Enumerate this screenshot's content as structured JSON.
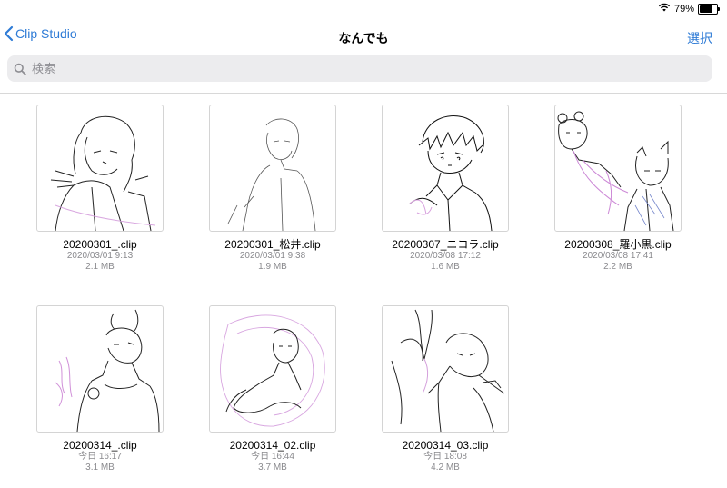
{
  "status": {
    "battery": "79%",
    "battery_level": 0.79
  },
  "nav": {
    "back_label": "Clip Studio",
    "title": "なんでも",
    "select_label": "選択"
  },
  "search": {
    "placeholder": "検索"
  },
  "colors": {
    "accent": "#2e7bd6"
  },
  "files": [
    {
      "name": "20200301_.clip",
      "date": "2020/03/01 9:13",
      "size": "2.1 MB"
    },
    {
      "name": "20200301_松井.clip",
      "date": "2020/03/01 9:38",
      "size": "1.9 MB"
    },
    {
      "name": "20200307_ニコラ.clip",
      "date": "2020/03/08 17:12",
      "size": "1.6 MB"
    },
    {
      "name": "20200308_羅小黒.clip",
      "date": "2020/03/08 17:41",
      "size": "2.2 MB"
    },
    {
      "name": "20200314_.clip",
      "date": "今日 16:17",
      "size": "3.1 MB"
    },
    {
      "name": "20200314_02.clip",
      "date": "今日 16:44",
      "size": "3.7 MB"
    },
    {
      "name": "20200314_03.clip",
      "date": "今日 18:08",
      "size": "4.2 MB"
    }
  ]
}
